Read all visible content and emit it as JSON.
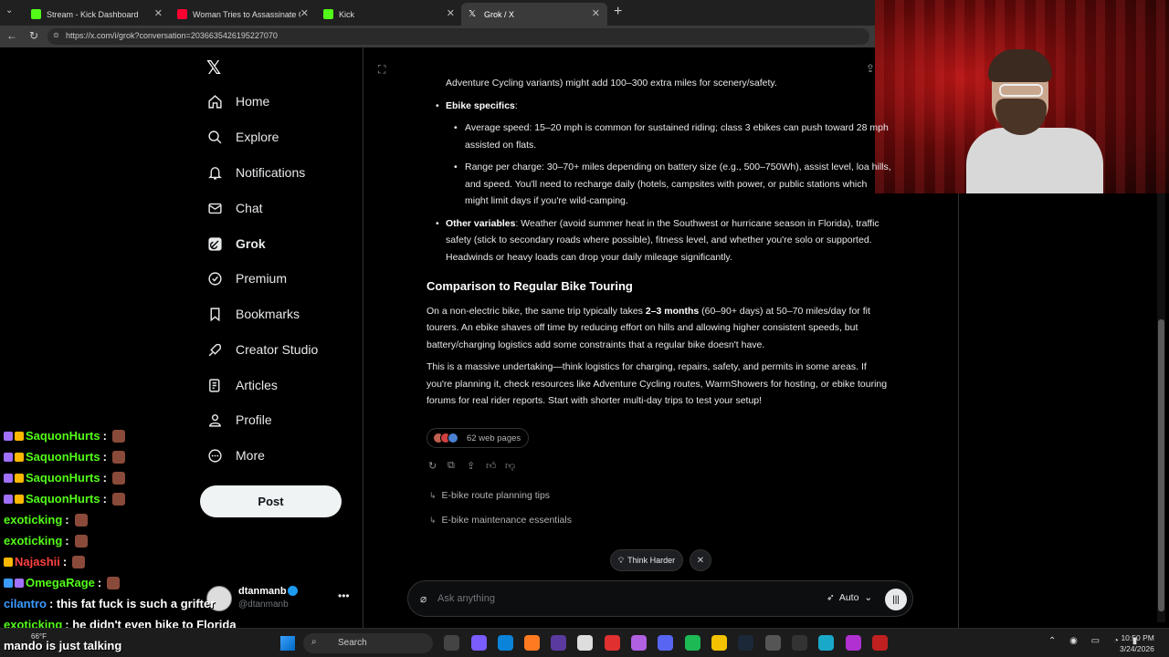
{
  "browser": {
    "tabs": [
      {
        "label": "Stream - Kick Dashboard",
        "icon_color": "#53fc18",
        "active": false
      },
      {
        "label": "Woman Tries to Assassinate Cop D",
        "icon_color": "#ff0033",
        "active": false
      },
      {
        "label": "Kick",
        "icon_color": "#53fc18",
        "active": false
      },
      {
        "label": "Grok / X",
        "icon_color": "#ffffff",
        "active": true
      }
    ],
    "url": "https://x.com/i/grok?conversation=2036635426195227070"
  },
  "nav": {
    "items": [
      {
        "label": "Home",
        "icon": "home-icon",
        "active": false
      },
      {
        "label": "Explore",
        "icon": "search-icon",
        "active": false
      },
      {
        "label": "Notifications",
        "icon": "bell-icon",
        "active": false
      },
      {
        "label": "Chat",
        "icon": "mail-icon",
        "active": false
      },
      {
        "label": "Grok",
        "icon": "grok-icon",
        "active": true
      },
      {
        "label": "Premium",
        "icon": "premium-icon",
        "active": false
      },
      {
        "label": "Bookmarks",
        "icon": "bookmark-icon",
        "active": false
      },
      {
        "label": "Creator Studio",
        "icon": "rocket-icon",
        "active": false
      },
      {
        "label": "Articles",
        "icon": "article-icon",
        "active": false
      },
      {
        "label": "Profile",
        "icon": "person-icon",
        "active": false
      },
      {
        "label": "More",
        "icon": "more-icon",
        "active": false
      }
    ],
    "post_label": "Post"
  },
  "account": {
    "name": "dtanmanb",
    "handle": "@dtanmanb"
  },
  "chat_overlay": [
    {
      "user": "SaquonHurts",
      "color": "#53fc18",
      "text": ":"
    },
    {
      "user": "SaquonHurts",
      "color": "#53fc18",
      "text": ":"
    },
    {
      "user": "SaquonHurts",
      "color": "#53fc18",
      "text": ":"
    },
    {
      "user": "SaquonHurts",
      "color": "#53fc18",
      "text": ":"
    },
    {
      "user": "exoticking",
      "color": "#53fc18",
      "text": ":"
    },
    {
      "user": "exoticking",
      "color": "#53fc18",
      "text": ":"
    },
    {
      "user": "Najashii",
      "color": "#ff4040",
      "text": ":"
    },
    {
      "user": "OmegaRage",
      "color": "#53fc18",
      "text": ":"
    },
    {
      "user": "cilantro",
      "color": "#3a9cff",
      "text": ": this fat fuck is such a grifter"
    },
    {
      "user": "exoticking",
      "color": "#53fc18",
      "text": ": he didn't even bike to Florida"
    }
  ],
  "grok": {
    "top_fragment": "Adventure Cycling variants) might add 100–300 extra miles for scenery/safety.",
    "ebike_heading": "Ebike specifics",
    "ebike_colon": ":",
    "ebike_bullets": [
      "Average speed: 15–20 mph is common for sustained riding; class 3 ebikes can push toward 28 mph assisted on flats.",
      "Range per charge: 30–70+ miles depending on battery size (e.g., 500–750Wh), assist level, loa hills, and speed. You'll need to recharge daily (hotels, campsites with power, or public stations which might limit days if you're wild-camping."
    ],
    "other_label": "Other variables",
    "other_text": ": Weather (avoid summer heat in the Southwest or hurricane season in Florida), traffic safety (stick to secondary roads where possible), fitness level, and whether you're solo or supported. Headwinds or heavy loads can drop your daily mileage significantly.",
    "comparison_heading": "Comparison to Regular Bike Touring",
    "comparison_p1_before": "On a non-electric bike, the same trip typically takes ",
    "comparison_p1_bold": "2–3 months",
    "comparison_p1_after": " (60–90+ days) at 50–70 miles/day for fit tourers. An ebike shaves off time by reducing effort on hills and allowing higher consistent speeds, but battery/charging logistics add some constraints that a regular bike doesn't have.",
    "comparison_p2": "This is a massive undertaking—think logistics for charging, repairs, safety, and permits in some areas. If you're planning it, check resources like Adventure Cycling routes, WarmShowers for hosting, or ebike touring forums for real rider reports. Start with shorter multi-day trips to test your setup!",
    "sources_label": "62 web pages",
    "suggestions": [
      "E-bike route planning tips",
      "E-bike maintenance essentials"
    ],
    "think_harder": "Think Harder",
    "ask_placeholder": "Ask anything",
    "mode": "Auto"
  },
  "taskbar": {
    "temperature": "66°F",
    "search_label": "Search",
    "time": "10:50 PM",
    "date": "3/24/2026",
    "overlay_chat": "mando is just talking"
  }
}
